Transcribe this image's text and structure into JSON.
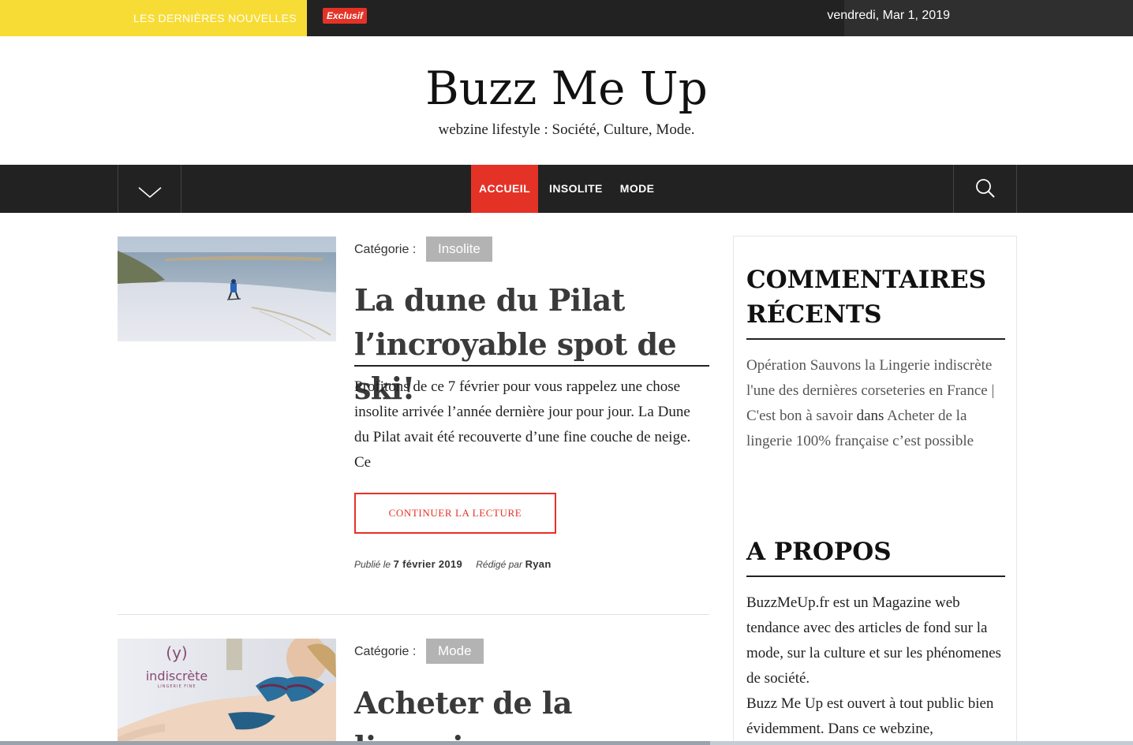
{
  "topbar": {
    "latest_label": "LES DERNIÈRES NOUVELLES",
    "exclusive_badge": "Exclusif",
    "date": "vendredi, Mar 1, 2019",
    "colors": {
      "latest_bg": "#f7dc35",
      "badge_bg": "#e53227",
      "bar_bg": "#222222"
    }
  },
  "header": {
    "title": "Buzz Me Up",
    "tagline": "webzine lifestyle : Société, Culture, Mode."
  },
  "nav": {
    "toggle_icon": "chevron-down-icon",
    "items": [
      {
        "label": "ACCUEIL",
        "active": true
      },
      {
        "label": "INSOLITE",
        "active": false
      },
      {
        "label": "MODE",
        "active": false
      }
    ],
    "search_icon": "search-icon",
    "accent": "#e53227"
  },
  "articles": [
    {
      "category_label": "Catégorie :",
      "category": "Insolite",
      "title_line1": "La dune du Pilat",
      "title_line2": "l’incroyable spot de ski!",
      "excerpt": "Profitons de ce 7 février pour vous rappelez une chose insolite arrivée l’année dernière jour pour jour. La Dune du Pilat avait été recouverte d’une fine couche de neige. Ce",
      "read_more": "CONTINUER LA LECTURE",
      "published_label": "Publié le",
      "published_date": "7 février 2019",
      "author_label": "Rédigé par",
      "author": "Ryan"
    },
    {
      "category_label": "Catégorie :",
      "category": "Mode",
      "title_line1": "Acheter de la lingerie",
      "image_brand": "(y)",
      "image_brand_name": "indiscrète",
      "image_brand_sub": "LINGERIE FINE"
    }
  ],
  "sidebar": {
    "recent_comments_title": "COMMENTAIRES RÉCENTS",
    "comment": {
      "author_link": "Opération Sauvons la Lingerie indiscrète l'une des dernières corseteries en France | C'est bon à savoir",
      "joiner": "dans",
      "post_link": "Acheter de la lingerie 100% française c’est possible"
    },
    "about_title": "A PROPOS",
    "about_text_1": "BuzzMeUp.fr est un Magazine web tendance avec des articles de fond sur la mode, sur la culture et sur les phénomenes de société.",
    "about_text_2": "Buzz Me Up est ouvert à tout public bien évidemment. Dans ce webzine,"
  }
}
